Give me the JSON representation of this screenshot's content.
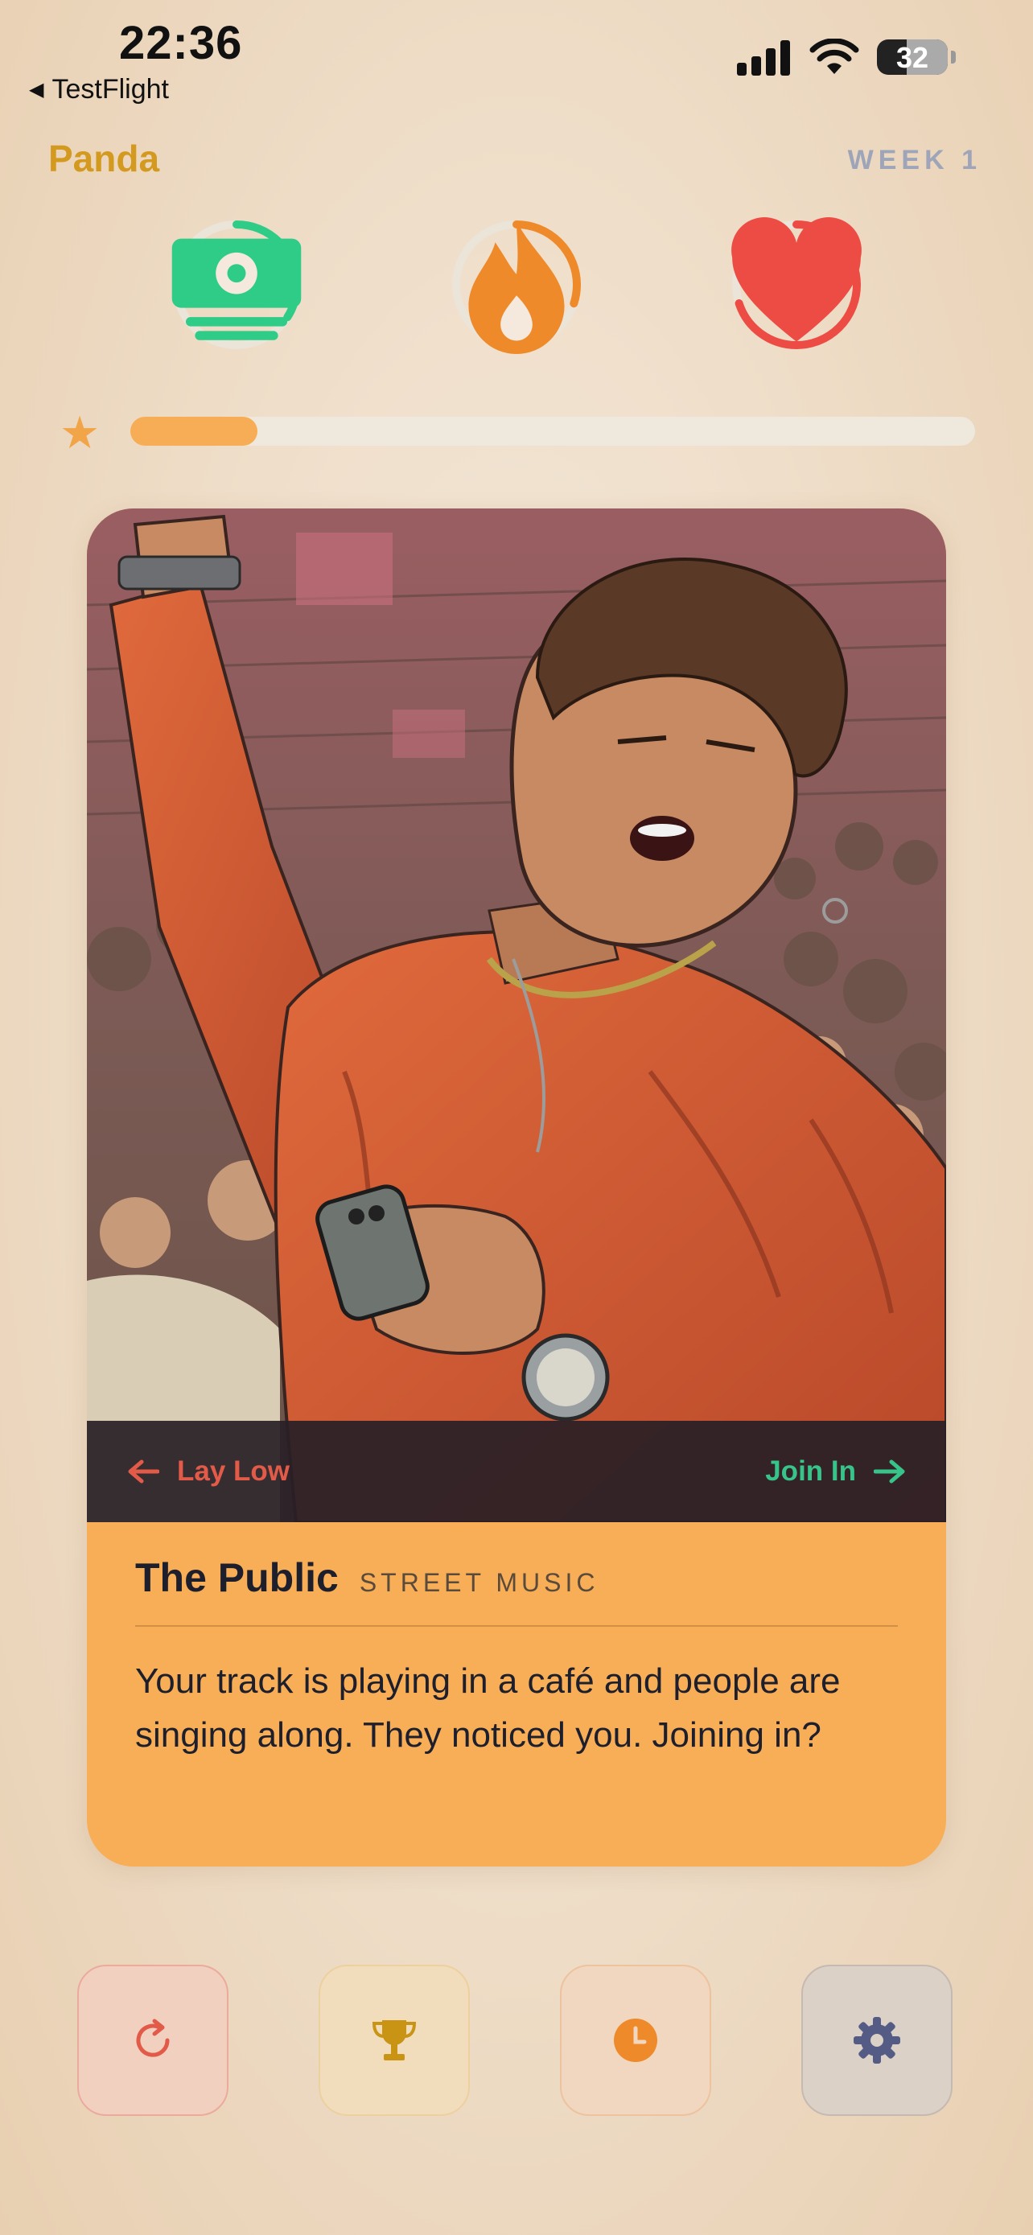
{
  "status_bar": {
    "time": "22:36",
    "back_app": "TestFlight",
    "battery": "32"
  },
  "header": {
    "player_name": "Panda",
    "week": "WEEK 1"
  },
  "stats": [
    {
      "name": "money",
      "icon": "money-icon",
      "color": "#2ecc87",
      "level": 0.34
    },
    {
      "name": "energy",
      "icon": "flame-icon",
      "color": "#ef8a2a",
      "level": 0.3
    },
    {
      "name": "health",
      "icon": "heart-icon",
      "color": "#ec4c43",
      "level": 0.7
    }
  ],
  "progress": {
    "icon": "star-icon",
    "level": 0.15,
    "color": "#f7ad55"
  },
  "card": {
    "choice_left": "Lay Low",
    "choice_right": "Join In",
    "title": "The Public",
    "category": "STREET MUSIC",
    "text": "Your track is playing in a café and people are singing along. They noticed you. Joining in?"
  },
  "toolbar": [
    {
      "name": "restart",
      "icon": "restart-icon",
      "color": "#e25a48"
    },
    {
      "name": "trophy",
      "icon": "trophy-icon",
      "color": "#c99414"
    },
    {
      "name": "history",
      "icon": "clock-icon",
      "color": "#ef8a2a"
    },
    {
      "name": "settings",
      "icon": "gear-icon",
      "color": "#545c85"
    }
  ]
}
